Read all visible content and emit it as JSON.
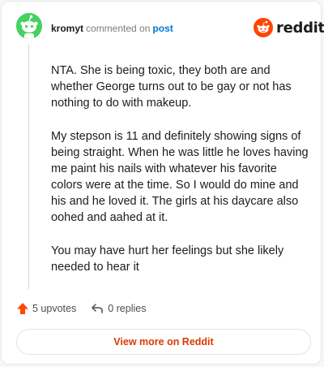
{
  "comment": {
    "username": "kromyt",
    "action_text": "commented on",
    "post_link_text": "post",
    "paragraphs": [
      "NTA. She is being toxic, they both are and whether George turns out to be gay or not has nothing to do with makeup.",
      "My stepson is 11 and definitely showing signs of being straight. When he was little he loves having me paint his nails with whatever his favorite colors were at the time. So I would do mine and his and he loved it. The girls at his daycare also oohed and aahed at it.",
      "You may have hurt her feelings but she likely needed to hear it"
    ]
  },
  "brand": {
    "logo_text": "reddit",
    "logo_icon": "reddit-alien-icon",
    "color": "#ff4500"
  },
  "actions": {
    "upvotes": "5 upvotes",
    "upvote_icon": "upvote-arrow-icon",
    "replies": "0 replies",
    "reply_icon": "reply-arrow-icon"
  },
  "view_more": {
    "label": "View more on Reddit"
  },
  "colors": {
    "avatar_bg": "#46d160",
    "link": "#0079d3",
    "cta": "#d93a00"
  }
}
